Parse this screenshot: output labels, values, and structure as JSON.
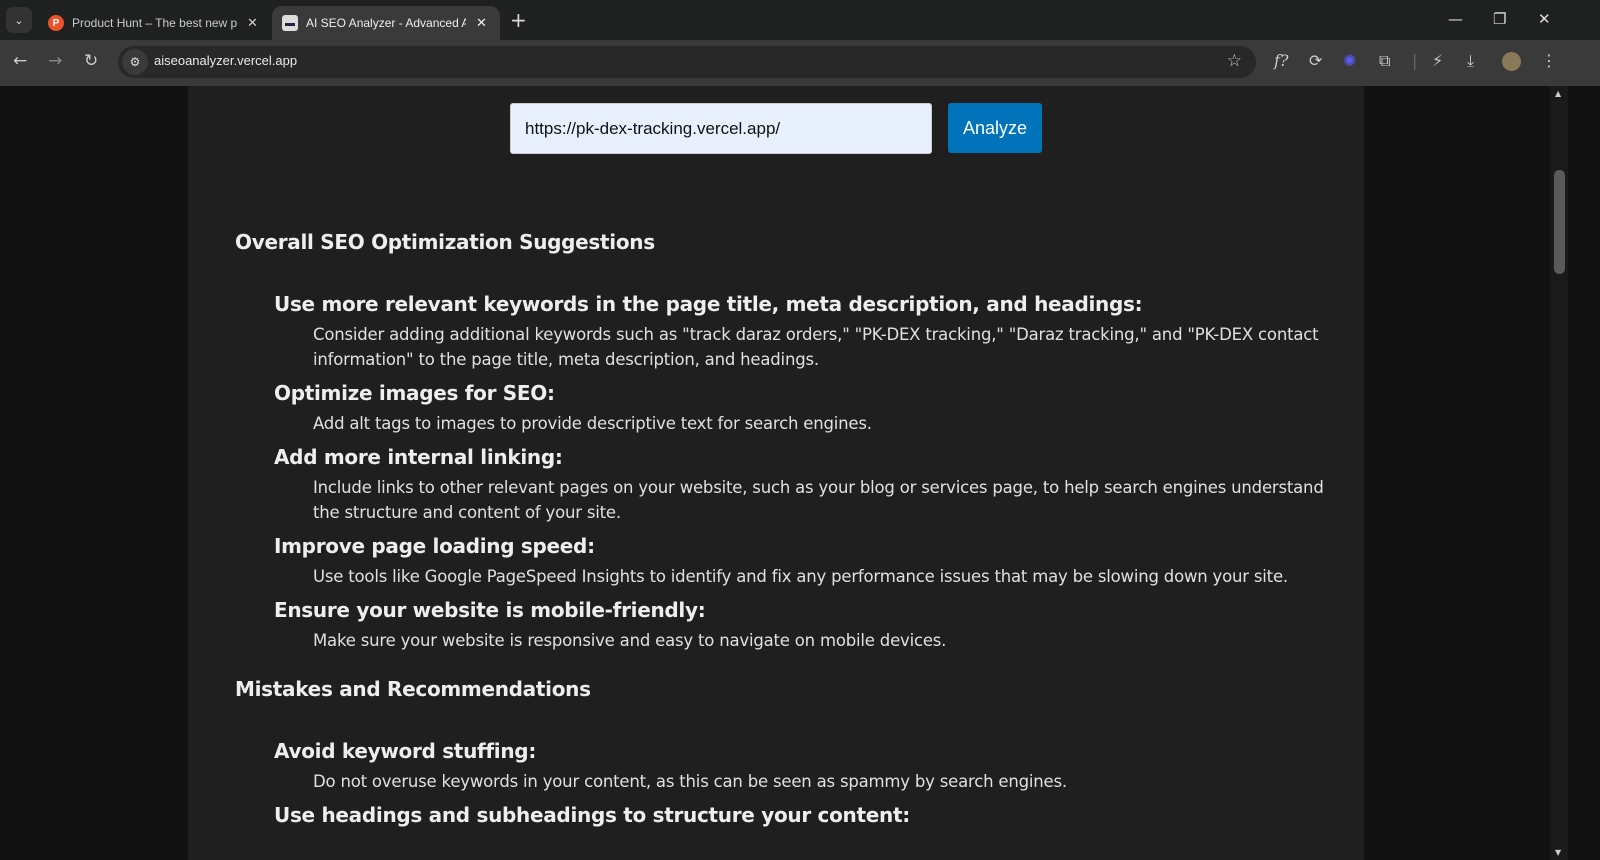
{
  "browser": {
    "tabs": [
      {
        "title": "Product Hunt – The best new products",
        "favicon": "P"
      },
      {
        "title": "AI SEO Analyzer - Advanced AI SEO",
        "favicon": "robot"
      }
    ],
    "url": "aiseoanalyzer.vercel.app"
  },
  "form": {
    "url_value": "https://pk-dex-tracking.vercel.app/",
    "analyze_label": "Analyze"
  },
  "sections": [
    {
      "title": "Overall SEO Optimization Suggestions",
      "items": [
        {
          "heading": "Use more relevant keywords in the page title, meta description, and headings:",
          "text": "Consider adding additional keywords such as \"track daraz orders,\" \"PK-DEX tracking,\" \"Daraz tracking,\" and \"PK-DEX contact information\" to the page title, meta description, and headings."
        },
        {
          "heading": "Optimize images for SEO:",
          "text": "Add alt tags to images to provide descriptive text for search engines."
        },
        {
          "heading": "Add more internal linking:",
          "text": "Include links to other relevant pages on your website, such as your blog or services page, to help search engines understand the structure and content of your site."
        },
        {
          "heading": "Improve page loading speed:",
          "text": "Use tools like Google PageSpeed Insights to identify and fix any performance issues that may be slowing down your site."
        },
        {
          "heading": "Ensure your website is mobile-friendly:",
          "text": "Make sure your website is responsive and easy to navigate on mobile devices."
        }
      ]
    },
    {
      "title": "Mistakes and Recommendations",
      "items": [
        {
          "heading": "Avoid keyword stuffing:",
          "text": "Do not overuse keywords in your content, as this can be seen as spammy by search engines."
        },
        {
          "heading": "Use headings and subheadings to structure your content:"
        }
      ]
    }
  ]
}
